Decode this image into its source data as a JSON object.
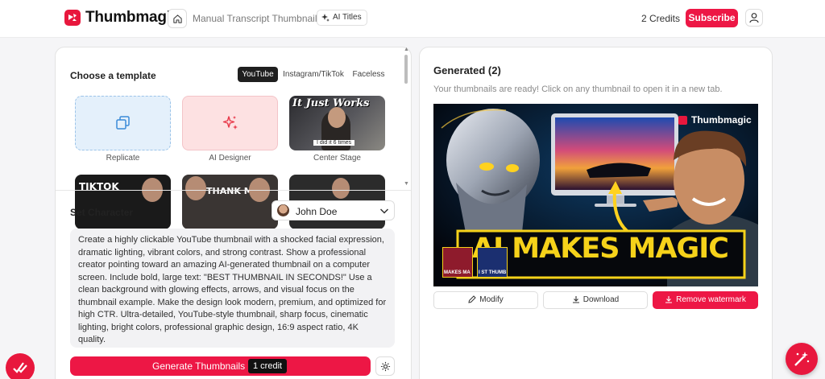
{
  "header": {
    "brand": "Thumbmagic",
    "breadcrumb": "Manual Transcript Thumbnail",
    "ai_titles": "AI Titles",
    "credits": "2 Credits",
    "subscribe": "Subscribe"
  },
  "templates": {
    "title": "Choose a template",
    "tabs": [
      "YouTube",
      "Instagram/TikTok",
      "Faceless"
    ],
    "active_tab": "YouTube",
    "cards": [
      {
        "label": "Replicate",
        "icon": "copy-icon"
      },
      {
        "label": "AI Designer",
        "icon": "sparkle-icon"
      },
      {
        "label": "Center Stage",
        "thumb_title": "It Just Works",
        "thumb_caption": "I did it 6 times"
      }
    ],
    "second_row": [
      {
        "thumb_text": "TIKTOK"
      },
      {
        "thumb_text": "THANK ME"
      },
      {
        "thumb_text": ""
      }
    ]
  },
  "character": {
    "label": "Set Character",
    "selected": "John Doe"
  },
  "prompt": {
    "text": "Create a highly clickable YouTube thumbnail with a shocked facial expression, dramatic lighting, vibrant colors, and strong contrast. Show a professional creator pointing toward an amazing AI-generated thumbnail on a computer screen. Include bold, large text: \"BEST THUMBNAIL IN SECONDS!\" Use a clean background with glowing effects, arrows, and visual focus on the thumbnail example. Make the design look modern, premium, and optimized for high CTR. Ultra-detailed, YouTube-style thumbnail, sharp focus, cinematic lighting, bright colors, professional graphic design, 16:9 aspect ratio, 4K quality."
  },
  "generate": {
    "label": "Generate Thumbnails",
    "credit": "1 credit"
  },
  "results": {
    "title": "Generated (2)",
    "subtitle": "Your thumbnails are ready! Click on any thumbnail to open it in a new tab.",
    "thumb_headline": "AI MAKES MAGIC",
    "thumb_watermark": "Thumbmagic",
    "inset_1": "MAKES MA",
    "inset_2": "I ST THUMB",
    "actions": {
      "modify": "Modify",
      "download": "Download",
      "remove_watermark": "Remove watermark"
    }
  },
  "colors": {
    "accent": "#ED1745",
    "dark": "#111111",
    "headline_yellow": "#F6D21A"
  }
}
